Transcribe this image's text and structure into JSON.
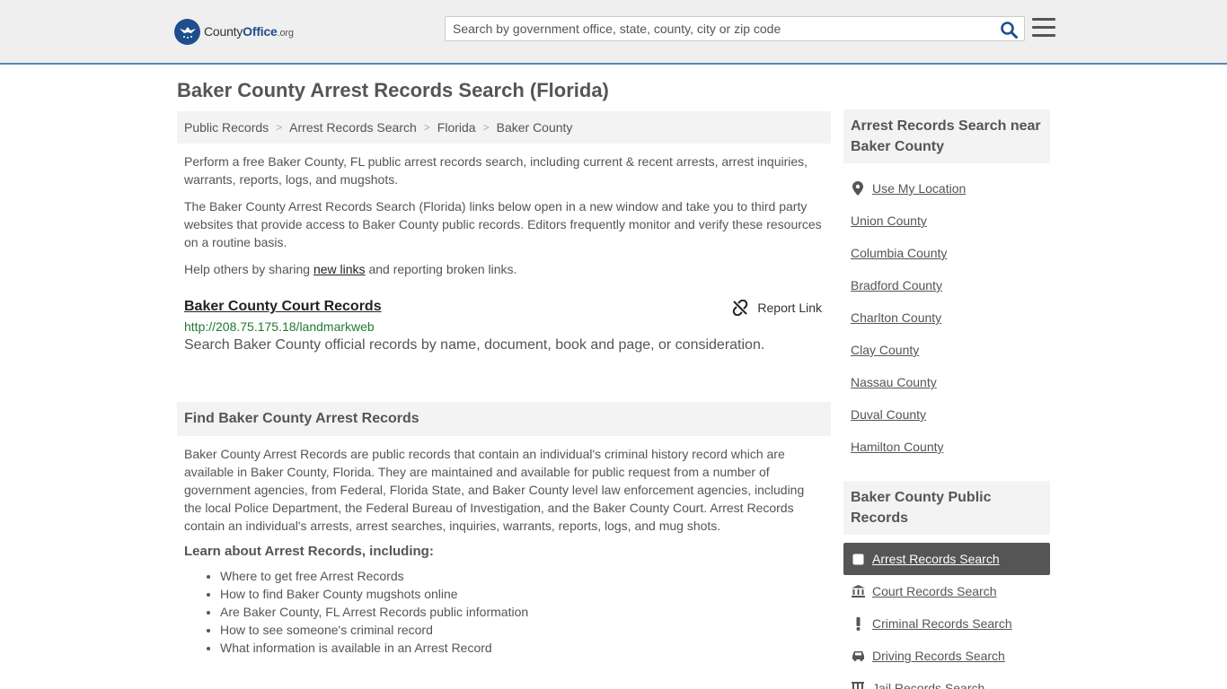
{
  "header": {
    "logo": {
      "brand_prefix": "County",
      "brand_main": "Office",
      "brand_suffix": ".org"
    },
    "search": {
      "placeholder": "Search by government office, state, county, city or zip code"
    }
  },
  "page_title": "Baker County Arrest Records Search (Florida)",
  "breadcrumb": [
    "Public Records",
    "Arrest Records Search",
    "Florida",
    "Baker County"
  ],
  "intro": {
    "p1": "Perform a free Baker County, FL public arrest records search, including current & recent arrests, arrest inquiries, warrants, reports, logs, and mugshots.",
    "p2": "The Baker County Arrest Records Search (Florida) links below open in a new window and take you to third party websites that provide access to Baker County public records. Editors frequently monitor and verify these resources on a routine basis.",
    "p3_before": "Help others by sharing ",
    "p3_link": "new links",
    "p3_after": " and reporting broken links."
  },
  "result": {
    "title": "Baker County Court Records",
    "report_label": "Report Link",
    "url": "http://208.75.175.18/landmarkweb",
    "description": "Search Baker County official records by name, document, book and page, or consideration."
  },
  "find_section": {
    "heading": "Find Baker County Arrest Records",
    "body": "Baker County Arrest Records are public records that contain an individual's criminal history record which are available in Baker County, Florida. They are maintained and available for public request from a number of government agencies, from Federal, Florida State, and Baker County level law enforcement agencies, including the local Police Department, the Federal Bureau of Investigation, and the Baker County Court. Arrest Records contain an individual's arrests, arrest searches, inquiries, warrants, reports, logs, and mug shots.",
    "learn_heading": "Learn about Arrest Records, including:",
    "learn_items": [
      "Where to get free Arrest Records",
      "How to find Baker County mugshots online",
      "Are Baker County, FL Arrest Records public information",
      "How to see someone's criminal record",
      "What information is available in an Arrest Record"
    ]
  },
  "sidebar": {
    "near_heading": "Arrest Records Search near Baker County",
    "use_location": "Use My Location",
    "near_items": [
      "Union County",
      "Columbia County",
      "Bradford County",
      "Charlton County",
      "Clay County",
      "Nassau County",
      "Duval County",
      "Hamilton County"
    ],
    "public_heading": "Baker County Public Records",
    "public_items": [
      {
        "label": "Arrest Records Search",
        "icon": "square-icon",
        "active": true
      },
      {
        "label": "Court Records Search",
        "icon": "courthouse-icon",
        "active": false
      },
      {
        "label": "Criminal Records Search",
        "icon": "exclamation-icon",
        "active": false
      },
      {
        "label": "Driving Records Search",
        "icon": "car-icon",
        "active": false
      },
      {
        "label": "Jail Records Search",
        "icon": "jail-icon",
        "active": false
      }
    ]
  },
  "colors": {
    "accent": "#1f4e8c",
    "header_border": "#5b86b4",
    "url_green": "#217a2f",
    "active_bg": "#555555"
  }
}
